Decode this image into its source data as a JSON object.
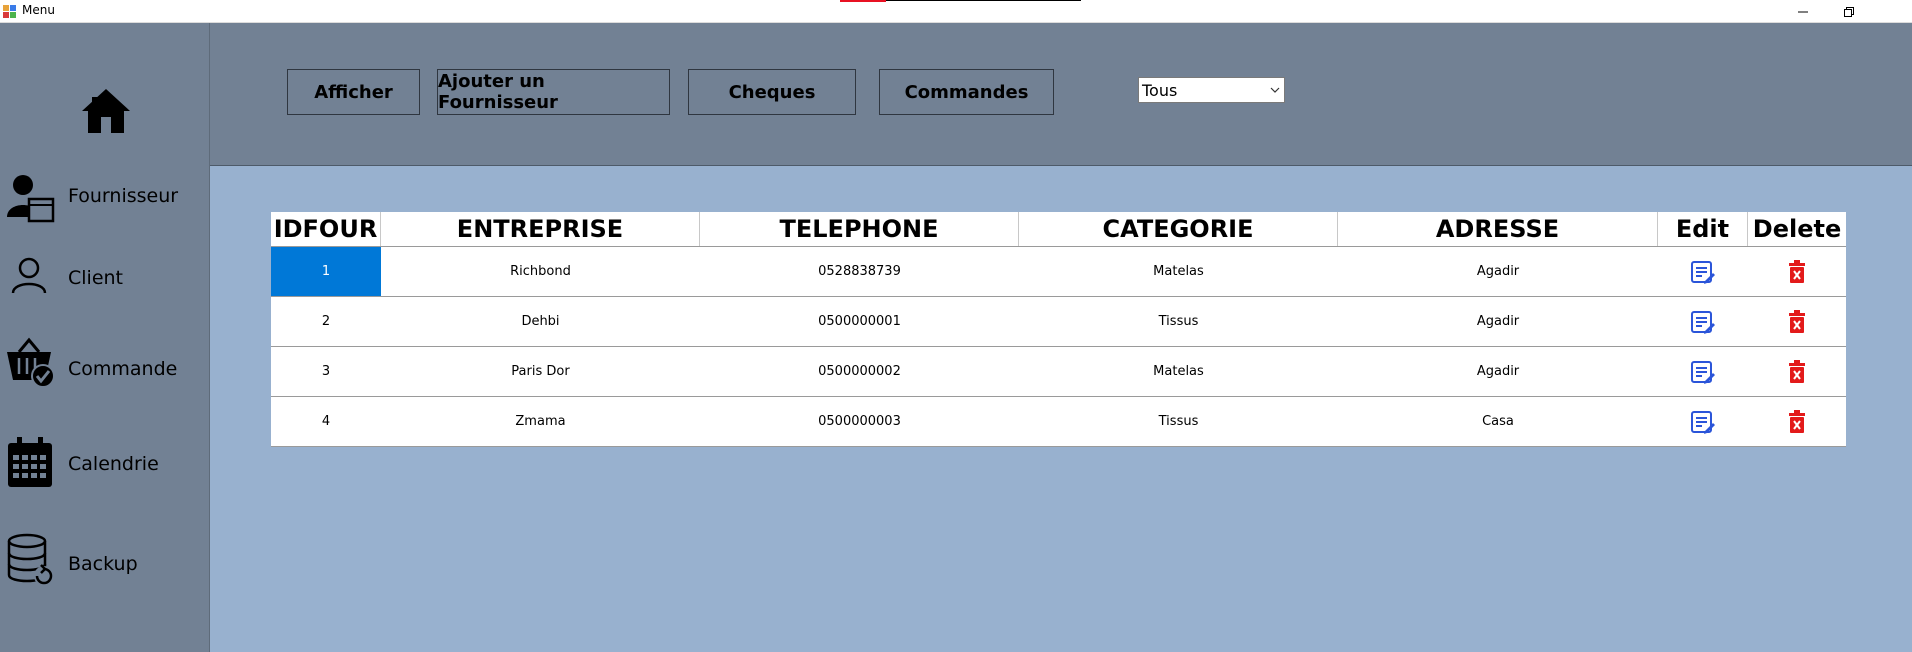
{
  "window": {
    "title": "Menu"
  },
  "sidebar": {
    "items": [
      {
        "label": "Fournisseur",
        "icon": "supplier-icon"
      },
      {
        "label": "Client",
        "icon": "user-icon"
      },
      {
        "label": "Commande",
        "icon": "basket-check-icon"
      },
      {
        "label": "Calendrie",
        "icon": "calendar-icon"
      },
      {
        "label": "Backup",
        "icon": "database-backup-icon"
      }
    ]
  },
  "toolbar": {
    "afficher_label": "Afficher",
    "ajouter_label": "Ajouter un Fournisseur",
    "cheques_label": "Cheques",
    "commandes_label": "Commandes",
    "filter_value": "Tous"
  },
  "table": {
    "columns": [
      "IDFOUR",
      "ENTREPRISE",
      "TELEPHONE",
      "CATEGORIE",
      "ADRESSE",
      "Edit",
      "Delete"
    ],
    "rows": [
      {
        "id": "1",
        "entreprise": "Richbond",
        "telephone": "0528838739",
        "categorie": "Matelas",
        "adresse": "Agadir"
      },
      {
        "id": "2",
        "entreprise": "Dehbi",
        "telephone": "0500000001",
        "categorie": "Tissus",
        "adresse": "Agadir"
      },
      {
        "id": "3",
        "entreprise": "Paris Dor",
        "telephone": "0500000002",
        "categorie": "Matelas",
        "adresse": "Agadir"
      },
      {
        "id": "4",
        "entreprise": "Zmama",
        "telephone": "0500000003",
        "categorie": "Tissus",
        "adresse": "Casa"
      }
    ],
    "selected_row": 0
  },
  "colors": {
    "sidebar_bg": "#728194",
    "content_bg": "#98b1cf",
    "selection": "#0078d7",
    "edit_icon": "#2b55d9",
    "delete_icon": "#e31a1a"
  }
}
